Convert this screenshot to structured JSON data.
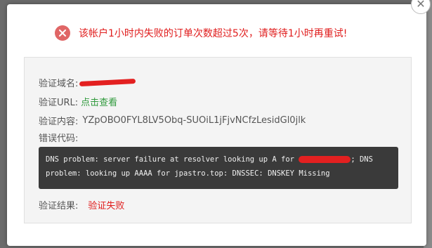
{
  "dialog": {
    "close_glyph": "✕",
    "alert_icon": "close-circle-icon",
    "alert_message": "该帐户1小时内失败的订单次数超过5次，请等待1小时再重试!"
  },
  "verification": {
    "domain_label": "验证域名:",
    "url_label": "验证URL:",
    "url_link_text": "点击查看",
    "content_label": "验证内容:",
    "content_value": "YZpOBO0FYL8LV5Obq-SUOiL1jFjvNCfzLesidGl0jlk",
    "error_label": "错误代码:",
    "error_code_part1": "DNS problem: server failure at resolver looking up A for ",
    "error_code_part2": "; DNS",
    "error_code_line2": "problem: looking up AAAA for jpastro.top: DNSSEC: DNSKEY Missing",
    "result_label": "验证结果:",
    "result_value": "验证失败"
  },
  "colors": {
    "error": "#e01c1c",
    "link": "#2f9a3c",
    "code_bg": "#3a3a3a",
    "panel_bg": "#f4f4f4"
  }
}
